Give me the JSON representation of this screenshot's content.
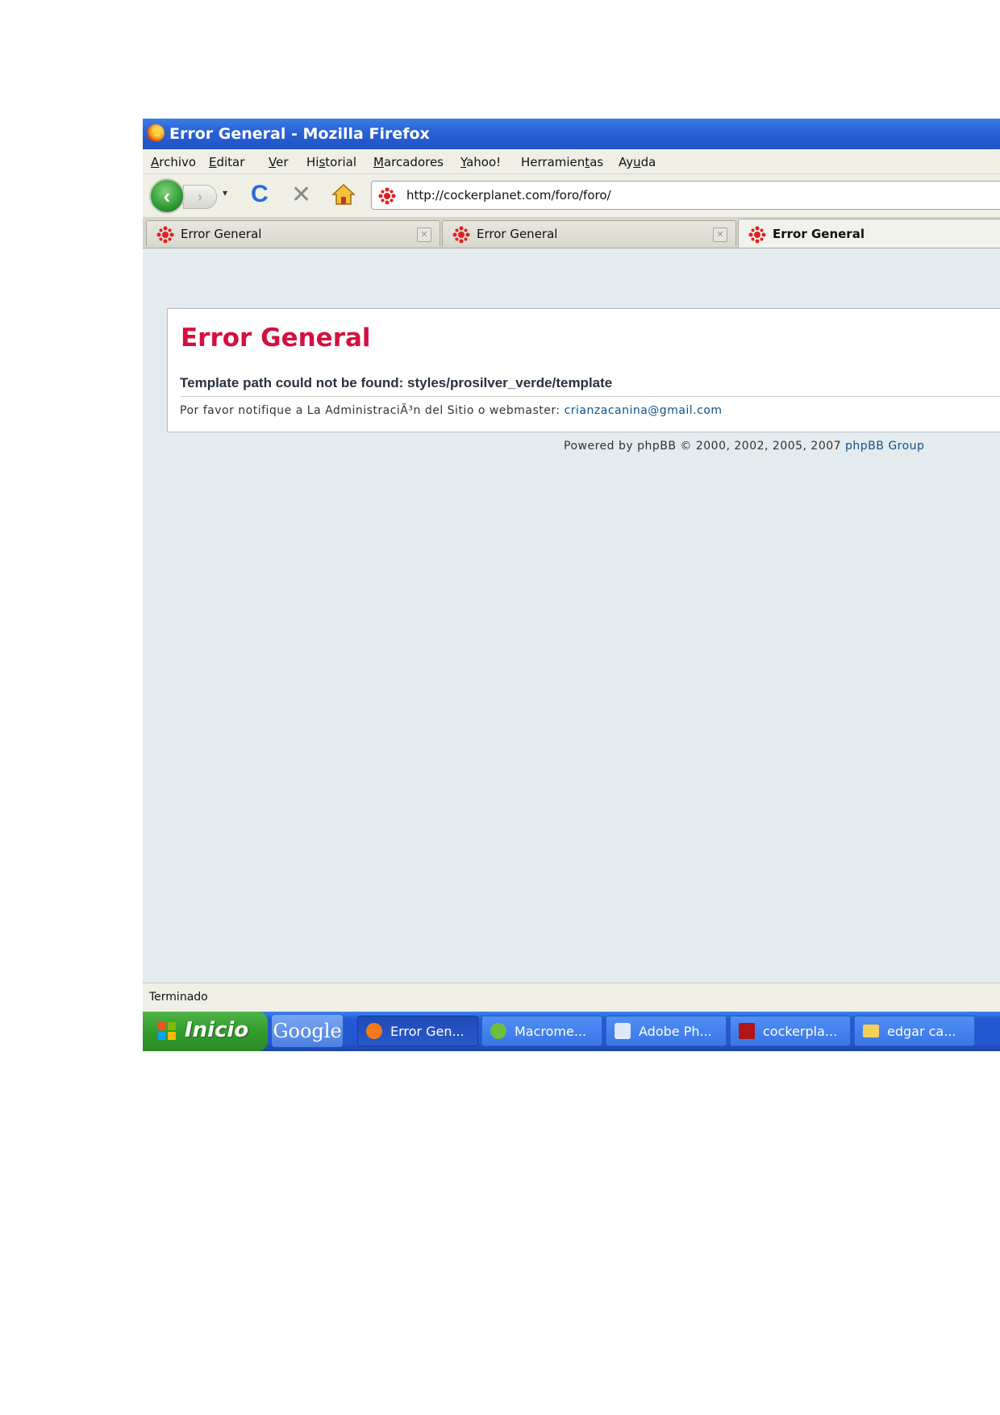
{
  "window": {
    "title": "Error General - Mozilla Firefox"
  },
  "menubar": {
    "items": [
      {
        "label": "Archivo",
        "access": "A",
        "rest": "rchivo"
      },
      {
        "label": "Editar",
        "access": "E",
        "rest": "ditar"
      },
      {
        "label": "Ver",
        "access": "V",
        "rest": "er"
      },
      {
        "label": "Historial",
        "pre": "Hi",
        "access": "s",
        "rest": "torial"
      },
      {
        "label": "Marcadores",
        "access": "M",
        "rest": "arcadores"
      },
      {
        "label": "Yahoo!",
        "access": "Y",
        "rest": "ahoo!"
      },
      {
        "label": "Herramientas",
        "pre": "Herramien",
        "access": "t",
        "rest": "as"
      },
      {
        "label": "Ayuda",
        "pre": "Ay",
        "access": "u",
        "rest": "da"
      }
    ]
  },
  "navbar": {
    "back_icon": "‹",
    "forward_icon": "›",
    "dropdown_icon": "▾",
    "reload_icon": "C",
    "stop_icon": "✕",
    "url": "http://cockerplanet.com/foro/foro/"
  },
  "tabs": [
    {
      "label": "Error General",
      "active": false
    },
    {
      "label": "Error General",
      "active": false
    },
    {
      "label": "Error General",
      "active": true
    }
  ],
  "content": {
    "error_title": "Error General",
    "error_message": "Template path could not be found: styles/prosilver_verde/template",
    "notify_prefix": "Por favor notifique a La AdministraciÃ³n del Sitio o webmaster: ",
    "notify_email": "crianzacanina@gmail.com",
    "powered_prefix": "Powered by phpBB © 2000, 2002, 2005, 2007 ",
    "powered_link": "phpBB Group"
  },
  "statusbar": {
    "text": "Terminado"
  },
  "taskbar": {
    "start_label": "Inicio",
    "google_label": "Google",
    "tasks": [
      {
        "label": "Error Gen...",
        "icon": "firefox-icon",
        "color": "#f27a1a",
        "active": true
      },
      {
        "label": "Macrome...",
        "icon": "macromedia-icon",
        "color": "#6cbf3a",
        "active": false
      },
      {
        "label": "Adobe Ph...",
        "icon": "photoshop-icon",
        "color": "#dfe8f7",
        "active": false
      },
      {
        "label": "cockerpla...",
        "icon": "filezilla-icon",
        "color": "#b3141a",
        "active": false
      },
      {
        "label": "edgar ca...",
        "icon": "folder-icon",
        "color": "#f4cf5a",
        "active": false
      }
    ]
  },
  "colors": {
    "error_title": "#d31141",
    "link": "#105289",
    "page_background": "#e3ebee"
  }
}
